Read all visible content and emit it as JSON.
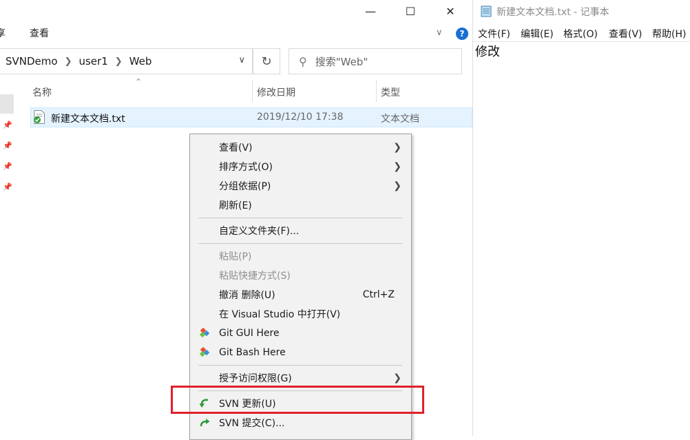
{
  "explorer": {
    "window_buttons": [
      "—",
      "☐",
      "✕"
    ],
    "ribbon_tabs": [
      "享",
      "查看"
    ],
    "address_segments": [
      "SVNDemo",
      "user1",
      "Web"
    ],
    "search_placeholder": "搜索\"Web\"",
    "columns": [
      "名称",
      "修改日期",
      "类型"
    ],
    "files": [
      {
        "name": "新建文本文档.txt",
        "date": "2019/12/10 17:38",
        "type": "文本文档"
      }
    ]
  },
  "notepad": {
    "title": "新建文本文档.txt - 记事本",
    "menus": [
      "文件(F)",
      "编辑(E)",
      "格式(O)",
      "查看(V)",
      "帮助(H)"
    ],
    "content": "修改"
  },
  "context_menu": {
    "items": [
      {
        "label": "查看(V)"
      },
      {
        "label": "排序方式(O)"
      },
      {
        "label": "分组依据(P)"
      },
      {
        "label": "刷新(E)"
      },
      {
        "label": "自定义文件夹(F)..."
      },
      {
        "label": "粘贴(P)"
      },
      {
        "label": "粘贴快捷方式(S)"
      },
      {
        "label": "撤消 删除(U)",
        "shortcut": "Ctrl+Z"
      },
      {
        "label": "在 Visual Studio 中打开(V)"
      },
      {
        "label": "Git GUI Here"
      },
      {
        "label": "Git Bash Here"
      },
      {
        "label": "授予访问权限(G)"
      },
      {
        "label": "SVN 更新(U)"
      },
      {
        "label": "SVN 提交(C)..."
      }
    ]
  },
  "colors": {
    "highlight_box": "#e0202a",
    "selection": "#e5f3ff",
    "help_badge": "#1a6fd4"
  }
}
